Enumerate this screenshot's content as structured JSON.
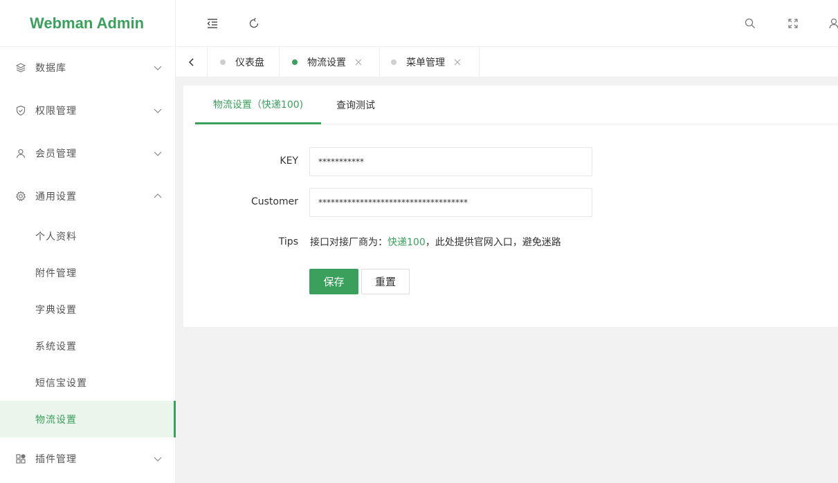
{
  "app": {
    "title": "Webman Admin"
  },
  "sidebar": {
    "menus": [
      {
        "label": "数据库",
        "icon": "layers-icon",
        "expanded": false
      },
      {
        "label": "权限管理",
        "icon": "shield-icon",
        "expanded": false
      },
      {
        "label": "会员管理",
        "icon": "user-icon",
        "expanded": false
      },
      {
        "label": "通用设置",
        "icon": "gear-icon",
        "expanded": true
      },
      {
        "label": "插件管理",
        "icon": "apps-icon",
        "expanded": false
      }
    ],
    "sub_items": [
      {
        "label": "个人资料",
        "active": false
      },
      {
        "label": "附件管理",
        "active": false
      },
      {
        "label": "字典设置",
        "active": false
      },
      {
        "label": "系统设置",
        "active": false
      },
      {
        "label": "短信宝设置",
        "active": false
      },
      {
        "label": "物流设置",
        "active": true
      }
    ]
  },
  "header": {
    "icons": [
      "menu-fold-icon",
      "refresh-icon",
      "search-icon",
      "fullscreen-icon",
      "user-icon"
    ]
  },
  "tabs": [
    {
      "label": "仪表盘",
      "closable": false,
      "active": false
    },
    {
      "label": "物流设置",
      "closable": true,
      "active": true
    },
    {
      "label": "菜单管理",
      "closable": true,
      "active": false
    }
  ],
  "page": {
    "subtabs": [
      {
        "label": "物流设置（快递100)",
        "active": true
      },
      {
        "label": "查询测试",
        "active": false
      }
    ],
    "form": {
      "key_label": "KEY",
      "key_value": "***********",
      "customer_label": "Customer",
      "customer_value": "************************************",
      "tips_label": "Tips",
      "tips_prefix": "接口对接厂商为：",
      "tips_link": "快递100",
      "tips_suffix": "，此处提供官网入口，避免迷路"
    },
    "buttons": {
      "save": "保存",
      "reset": "重置"
    }
  },
  "colors": {
    "accent": "#3aa05c",
    "active_bg": "#eaf5ec",
    "background": "#f2f2f2"
  }
}
